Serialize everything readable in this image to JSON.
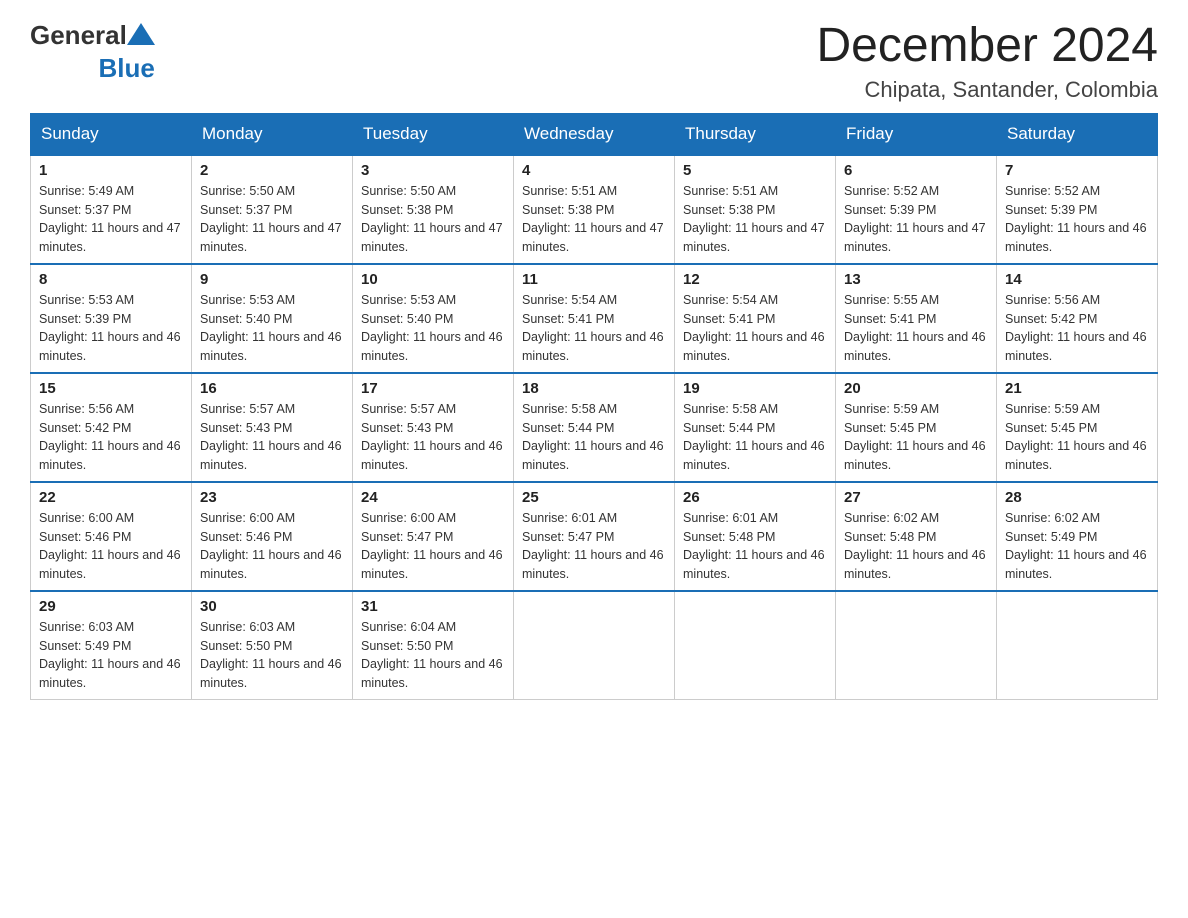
{
  "header": {
    "month_title": "December 2024",
    "location": "Chipata, Santander, Colombia"
  },
  "logo": {
    "general": "General",
    "blue": "Blue"
  },
  "days_of_week": [
    "Sunday",
    "Monday",
    "Tuesday",
    "Wednesday",
    "Thursday",
    "Friday",
    "Saturday"
  ],
  "weeks": [
    [
      {
        "num": "1",
        "sunrise": "5:49 AM",
        "sunset": "5:37 PM",
        "daylight": "11 hours and 47 minutes."
      },
      {
        "num": "2",
        "sunrise": "5:50 AM",
        "sunset": "5:37 PM",
        "daylight": "11 hours and 47 minutes."
      },
      {
        "num": "3",
        "sunrise": "5:50 AM",
        "sunset": "5:38 PM",
        "daylight": "11 hours and 47 minutes."
      },
      {
        "num": "4",
        "sunrise": "5:51 AM",
        "sunset": "5:38 PM",
        "daylight": "11 hours and 47 minutes."
      },
      {
        "num": "5",
        "sunrise": "5:51 AM",
        "sunset": "5:38 PM",
        "daylight": "11 hours and 47 minutes."
      },
      {
        "num": "6",
        "sunrise": "5:52 AM",
        "sunset": "5:39 PM",
        "daylight": "11 hours and 47 minutes."
      },
      {
        "num": "7",
        "sunrise": "5:52 AM",
        "sunset": "5:39 PM",
        "daylight": "11 hours and 46 minutes."
      }
    ],
    [
      {
        "num": "8",
        "sunrise": "5:53 AM",
        "sunset": "5:39 PM",
        "daylight": "11 hours and 46 minutes."
      },
      {
        "num": "9",
        "sunrise": "5:53 AM",
        "sunset": "5:40 PM",
        "daylight": "11 hours and 46 minutes."
      },
      {
        "num": "10",
        "sunrise": "5:53 AM",
        "sunset": "5:40 PM",
        "daylight": "11 hours and 46 minutes."
      },
      {
        "num": "11",
        "sunrise": "5:54 AM",
        "sunset": "5:41 PM",
        "daylight": "11 hours and 46 minutes."
      },
      {
        "num": "12",
        "sunrise": "5:54 AM",
        "sunset": "5:41 PM",
        "daylight": "11 hours and 46 minutes."
      },
      {
        "num": "13",
        "sunrise": "5:55 AM",
        "sunset": "5:41 PM",
        "daylight": "11 hours and 46 minutes."
      },
      {
        "num": "14",
        "sunrise": "5:56 AM",
        "sunset": "5:42 PM",
        "daylight": "11 hours and 46 minutes."
      }
    ],
    [
      {
        "num": "15",
        "sunrise": "5:56 AM",
        "sunset": "5:42 PM",
        "daylight": "11 hours and 46 minutes."
      },
      {
        "num": "16",
        "sunrise": "5:57 AM",
        "sunset": "5:43 PM",
        "daylight": "11 hours and 46 minutes."
      },
      {
        "num": "17",
        "sunrise": "5:57 AM",
        "sunset": "5:43 PM",
        "daylight": "11 hours and 46 minutes."
      },
      {
        "num": "18",
        "sunrise": "5:58 AM",
        "sunset": "5:44 PM",
        "daylight": "11 hours and 46 minutes."
      },
      {
        "num": "19",
        "sunrise": "5:58 AM",
        "sunset": "5:44 PM",
        "daylight": "11 hours and 46 minutes."
      },
      {
        "num": "20",
        "sunrise": "5:59 AM",
        "sunset": "5:45 PM",
        "daylight": "11 hours and 46 minutes."
      },
      {
        "num": "21",
        "sunrise": "5:59 AM",
        "sunset": "5:45 PM",
        "daylight": "11 hours and 46 minutes."
      }
    ],
    [
      {
        "num": "22",
        "sunrise": "6:00 AM",
        "sunset": "5:46 PM",
        "daylight": "11 hours and 46 minutes."
      },
      {
        "num": "23",
        "sunrise": "6:00 AM",
        "sunset": "5:46 PM",
        "daylight": "11 hours and 46 minutes."
      },
      {
        "num": "24",
        "sunrise": "6:00 AM",
        "sunset": "5:47 PM",
        "daylight": "11 hours and 46 minutes."
      },
      {
        "num": "25",
        "sunrise": "6:01 AM",
        "sunset": "5:47 PM",
        "daylight": "11 hours and 46 minutes."
      },
      {
        "num": "26",
        "sunrise": "6:01 AM",
        "sunset": "5:48 PM",
        "daylight": "11 hours and 46 minutes."
      },
      {
        "num": "27",
        "sunrise": "6:02 AM",
        "sunset": "5:48 PM",
        "daylight": "11 hours and 46 minutes."
      },
      {
        "num": "28",
        "sunrise": "6:02 AM",
        "sunset": "5:49 PM",
        "daylight": "11 hours and 46 minutes."
      }
    ],
    [
      {
        "num": "29",
        "sunrise": "6:03 AM",
        "sunset": "5:49 PM",
        "daylight": "11 hours and 46 minutes."
      },
      {
        "num": "30",
        "sunrise": "6:03 AM",
        "sunset": "5:50 PM",
        "daylight": "11 hours and 46 minutes."
      },
      {
        "num": "31",
        "sunrise": "6:04 AM",
        "sunset": "5:50 PM",
        "daylight": "11 hours and 46 minutes."
      },
      null,
      null,
      null,
      null
    ]
  ]
}
